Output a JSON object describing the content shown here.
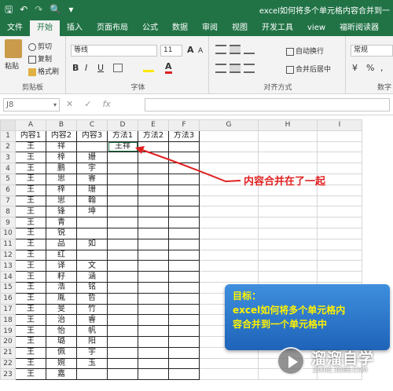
{
  "window": {
    "title": "excel如何将多个单元格内容合并到一",
    "qat": {
      "save": "🖫",
      "undo": "↶",
      "redo": "↷",
      "print_preview": "🔍",
      "dropdown": "▾"
    }
  },
  "ribbon": {
    "tabs": [
      "文件",
      "开始",
      "插入",
      "页面布局",
      "公式",
      "数据",
      "审阅",
      "视图",
      "开发工具",
      "view",
      "福昕阅读器"
    ],
    "active_tab": "开始",
    "clipboard": {
      "paste": "粘贴",
      "cut": "剪切",
      "copy": "复制",
      "format_painter": "格式刷",
      "group": "剪贴板"
    },
    "font": {
      "name": "等线",
      "size": "11",
      "bold": "B",
      "italic": "I",
      "underline": "U",
      "font_color_letter": "A",
      "grow": "A",
      "shrink": "A",
      "group": "字体"
    },
    "alignment": {
      "wrap": "自动换行",
      "merge": "合并后居中",
      "group": "对齐方式"
    },
    "number": {
      "format": "常规",
      "currency": "¥",
      "percent": "%",
      "comma": ",",
      "group": "数字"
    }
  },
  "formula_bar": {
    "name_box": "J8",
    "cancel": "✕",
    "enter": "✓",
    "fx": "fx",
    "value": ""
  },
  "sheet": {
    "columns": [
      "A",
      "B",
      "C",
      "D",
      "E",
      "F",
      "G",
      "H",
      "I"
    ],
    "rows": [
      {
        "num": "1",
        "cells": [
          "内容1",
          "内容2",
          "内容3",
          "方法1",
          "方法2",
          "方法3",
          "",
          "",
          ""
        ]
      },
      {
        "num": "2",
        "cells": [
          "王",
          "祥",
          "",
          "王祥",
          "",
          "",
          "",
          "",
          ""
        ]
      },
      {
        "num": "3",
        "cells": [
          "王",
          "梓",
          "姗",
          "",
          "",
          "",
          "",
          "",
          ""
        ]
      },
      {
        "num": "4",
        "cells": [
          "王",
          "鹏",
          "宇",
          "",
          "",
          "",
          "",
          "",
          ""
        ]
      },
      {
        "num": "5",
        "cells": [
          "王",
          "思",
          "睿",
          "",
          "",
          "",
          "",
          "",
          ""
        ]
      },
      {
        "num": "6",
        "cells": [
          "王",
          "梓",
          "珊",
          "",
          "",
          "",
          "",
          "",
          ""
        ]
      },
      {
        "num": "7",
        "cells": [
          "王",
          "思",
          "翰",
          "",
          "",
          "",
          "",
          "",
          ""
        ]
      },
      {
        "num": "8",
        "cells": [
          "王",
          "锋",
          "坤",
          "",
          "",
          "",
          "",
          "",
          ""
        ]
      },
      {
        "num": "9",
        "cells": [
          "王",
          "青",
          "",
          "",
          "",
          "",
          "",
          "",
          ""
        ]
      },
      {
        "num": "10",
        "cells": [
          "王",
          "锐",
          "",
          "",
          "",
          "",
          "",
          "",
          ""
        ]
      },
      {
        "num": "11",
        "cells": [
          "王",
          "品",
          "如",
          "",
          "",
          "",
          "",
          "",
          ""
        ]
      },
      {
        "num": "12",
        "cells": [
          "王",
          "红",
          "",
          "",
          "",
          "",
          "",
          "",
          ""
        ]
      },
      {
        "num": "13",
        "cells": [
          "王",
          "译",
          "文",
          "",
          "",
          "",
          "",
          "",
          ""
        ]
      },
      {
        "num": "14",
        "cells": [
          "王",
          "籽",
          "涵",
          "",
          "",
          "",
          "",
          "",
          ""
        ]
      },
      {
        "num": "15",
        "cells": [
          "王",
          "浩",
          "铭",
          "",
          "",
          "",
          "",
          "",
          ""
        ]
      },
      {
        "num": "16",
        "cells": [
          "王",
          "胤",
          "哲",
          "",
          "",
          "",
          "",
          "",
          ""
        ]
      },
      {
        "num": "17",
        "cells": [
          "王",
          "旻",
          "竹",
          "",
          "",
          "",
          "",
          "",
          ""
        ]
      },
      {
        "num": "18",
        "cells": [
          "王",
          "治",
          "睿",
          "",
          "",
          "",
          "",
          "",
          ""
        ]
      },
      {
        "num": "19",
        "cells": [
          "王",
          "怡",
          "帆",
          "",
          "",
          "",
          "",
          "",
          ""
        ]
      },
      {
        "num": "20",
        "cells": [
          "王",
          "璐",
          "阳",
          "",
          "",
          "",
          "",
          "",
          ""
        ]
      },
      {
        "num": "21",
        "cells": [
          "王",
          "佩",
          "宇",
          "",
          "",
          "",
          "",
          "",
          ""
        ]
      },
      {
        "num": "22",
        "cells": [
          "王",
          "婉",
          "玉",
          "",
          "",
          "",
          "",
          "",
          ""
        ]
      },
      {
        "num": "23",
        "cells": [
          "王",
          "嘉",
          "",
          "",
          "",
          "",
          "",
          "",
          ""
        ]
      }
    ]
  },
  "annotation": {
    "text": "内容合并在了一起",
    "color": "#e02020"
  },
  "goal_box": {
    "line1": "目标：",
    "line2": "excel如何将多个单元格内",
    "line3": "容合并到一个单元格中",
    "text_color": "#fff200"
  },
  "watermark": {
    "name": "溜溜自学",
    "url": "ZIXUE.3D66.COM"
  },
  "colors": {
    "excel_green": "#217346",
    "goal_blue": "#2e78cc"
  }
}
